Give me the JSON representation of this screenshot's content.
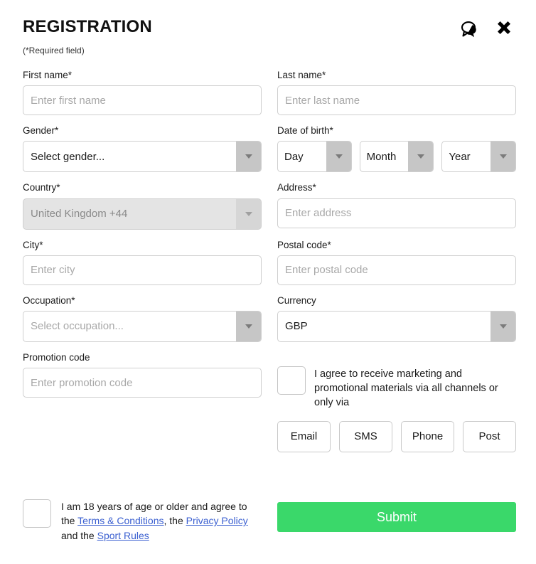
{
  "header": {
    "title": "REGISTRATION",
    "required_note": "(*Required field)",
    "chat_icon": "chat-bubbles-icon",
    "close_icon": "close-icon"
  },
  "fields": {
    "first_name": {
      "label": "First name*",
      "value": "",
      "placeholder": "Enter first name"
    },
    "last_name": {
      "label": "Last name*",
      "value": "",
      "placeholder": "Enter last name"
    },
    "gender": {
      "label": "Gender*",
      "value": "Select gender..."
    },
    "dob": {
      "label": "Date of birth*",
      "day": "Day",
      "month": "Month",
      "year": "Year"
    },
    "country": {
      "label": "Country*",
      "value": "United Kingdom +44"
    },
    "address": {
      "label": "Address*",
      "value": "",
      "placeholder": "Enter address"
    },
    "city": {
      "label": "City*",
      "value": "",
      "placeholder": "Enter city"
    },
    "postal_code": {
      "label": "Postal code*",
      "value": "",
      "placeholder": "Enter postal code"
    },
    "occupation": {
      "label": "Occupation*",
      "value": "Select occupation..."
    },
    "currency": {
      "label": "Currency",
      "value": "GBP"
    },
    "promotion_code": {
      "label": "Promotion code",
      "value": "",
      "placeholder": "Enter promotion code"
    }
  },
  "marketing": {
    "consent_text": "I agree to receive marketing and promotional materials via all channels or only via",
    "channels": [
      "Email",
      "SMS",
      "Phone",
      "Post"
    ]
  },
  "age_consent": {
    "part1": "I am 18 years of age or older and agree to the ",
    "link1": "Terms & Conditions",
    "part2": ", the ",
    "link2": "Privacy Policy",
    "part3": " and the ",
    "link3": "Sport Rules"
  },
  "submit": {
    "label": "Submit"
  },
  "colors": {
    "submit_green": "#3ad86a",
    "link_blue": "#3a5fd0",
    "arrow_gray": "#c6c6c6",
    "disabled_gray": "#e4e4e4"
  }
}
